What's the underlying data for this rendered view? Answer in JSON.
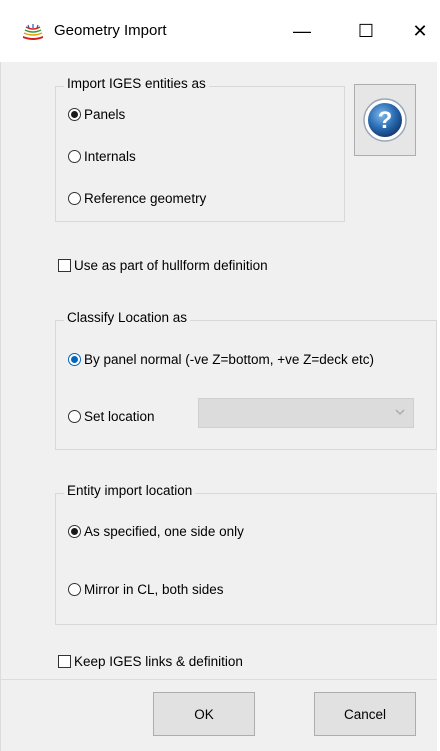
{
  "window": {
    "title": "Geometry Import",
    "minimize_glyph": "—",
    "maximize_glyph": "☐",
    "close_glyph": "✕"
  },
  "import_group": {
    "legend": "Import IGES entities  as",
    "options": [
      "Panels",
      "Internals",
      "Reference geometry"
    ],
    "selected": "Panels"
  },
  "hullform_checkbox": {
    "label": "Use as part of hullform definition",
    "checked": false
  },
  "classify_group": {
    "legend": "Classify Location as",
    "option_normal": "By panel normal (-ve Z=bottom, +ve Z=deck etc)",
    "option_set": "Set location",
    "selected": "By panel normal (-ve Z=bottom, +ve Z=deck etc)",
    "location_value": ""
  },
  "entity_group": {
    "legend": "Entity import location",
    "option_specified": "As specified, one side only",
    "option_mirror": "Mirror in CL, both sides",
    "selected": "As specified, one side only"
  },
  "keep_checkbox": {
    "label": "Keep IGES links & definition",
    "checked": false
  },
  "buttons": {
    "ok": "OK",
    "cancel": "Cancel"
  },
  "icons": {
    "app": "geometry-hull-icon",
    "help": "help-question-icon",
    "dropdown": "chevron-down-icon"
  },
  "colors": {
    "accent": "#0067c0",
    "client_bg": "#f0f0f0",
    "help_blue": "#2a6db4"
  }
}
